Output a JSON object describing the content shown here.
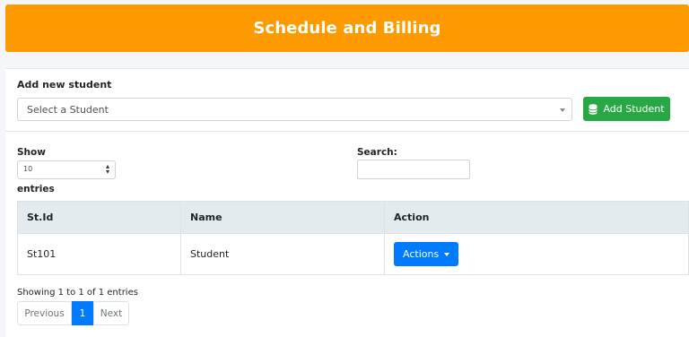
{
  "header": {
    "title": "Schedule and Billing"
  },
  "add_student": {
    "label": "Add new student",
    "select_placeholder": "Select a Student",
    "button_label": "Add Student"
  },
  "table_controls": {
    "show_label": "Show",
    "length_value": "10",
    "entries_label": "entries",
    "search_label": "Search:",
    "search_value": ""
  },
  "table": {
    "columns": [
      "St.Id",
      "Name",
      "Action"
    ],
    "rows": [
      {
        "id": "St101",
        "name": "Student",
        "action_label": "Actions"
      }
    ]
  },
  "footer": {
    "info": "Showing 1 to 1 of 1 entries",
    "previous": "Previous",
    "current_page": "1",
    "next": "Next"
  },
  "colors": {
    "header_bg": "#fd9a00",
    "add_button": "#28a745",
    "primary": "#007bff"
  },
  "icons": {
    "add_button_icon": "database-icon",
    "select_caret": "chevron-down-icon",
    "actions_caret": "caret-down-icon"
  }
}
